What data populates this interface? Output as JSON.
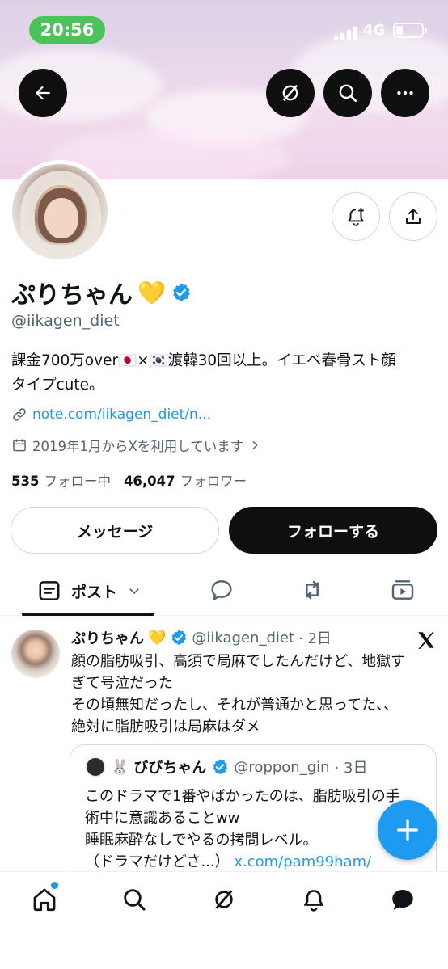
{
  "status_bar": {
    "time": "20:56",
    "network": "4G"
  },
  "header": {
    "back_icon": "arrow-left-icon",
    "grok_icon": "grok-icon",
    "search_icon": "search-icon",
    "more_icon": "more-icon"
  },
  "profile": {
    "name": "ぷりちゃん",
    "name_emoji": "💛",
    "handle": "@iikagen_diet",
    "bio_line1": "課金700万over🇯🇵×🇰🇷渡韓30回以上。イエベ春骨スト顔",
    "bio_line2": "タイプcute。",
    "link": "note.com/iikagen_diet/n...",
    "joined": "2019年1月からXを利用しています",
    "following_count": "535",
    "following_label": "フォロー中",
    "followers_count": "46,047",
    "followers_label": "フォロワー",
    "message_button": "メッセージ",
    "follow_button": "フォローする"
  },
  "tabs": {
    "post_label": "ポスト"
  },
  "tweet": {
    "name": "ぷりちゃん",
    "emoji": "💛",
    "handle": "@iikagen_diet",
    "time": "· 2日",
    "line1": "顔の脂肪吸引、高須で局麻でしたんだけど、地獄す",
    "line2": "ぎて号泣だった",
    "line3": "その頃無知だったし、それが普通かと思ってた、、",
    "line4": "絶対に脂肪吸引は局麻はダメ",
    "quote": {
      "name_prefix": "🐰",
      "name": "びびちゃん",
      "handle": "@roppon_gin",
      "time": "· 3日",
      "line1": "このドラマで1番やばかったのは、脂肪吸引の手",
      "line2": "術中に意識あることww",
      "line3": "睡眠麻酔なしでやるの拷問レベル。",
      "line4": "（ドラマだけどさ...）",
      "link": "x.com/pam99ham/"
    }
  },
  "colors": {
    "accent": "#1d9bf0",
    "status_pill": "#4cc35a",
    "dark": "#0f0f0f"
  }
}
